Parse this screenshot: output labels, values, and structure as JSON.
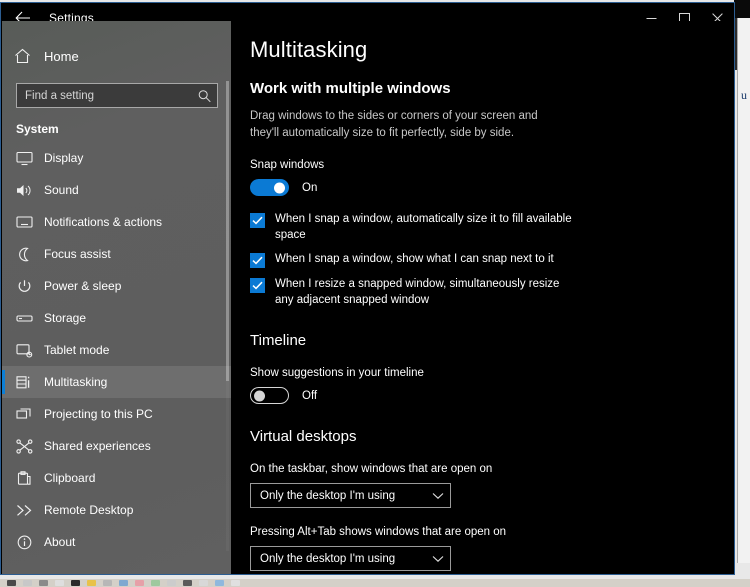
{
  "window": {
    "title": "Settings",
    "back_icon": "back-arrow-icon",
    "controls": {
      "minimize": "minimize-icon",
      "maximize": "maximize-icon",
      "close": "close-icon"
    }
  },
  "sidebar": {
    "home_label": "Home",
    "home_icon": "home-icon",
    "search": {
      "placeholder": "Find a setting",
      "value": "",
      "icon": "search-icon"
    },
    "group_title": "System",
    "items": [
      {
        "label": "Display",
        "icon": "monitor-icon",
        "selected": false
      },
      {
        "label": "Sound",
        "icon": "speaker-icon",
        "selected": false
      },
      {
        "label": "Notifications & actions",
        "icon": "notification-icon",
        "selected": false
      },
      {
        "label": "Focus assist",
        "icon": "moon-icon",
        "selected": false
      },
      {
        "label": "Power & sleep",
        "icon": "power-icon",
        "selected": false
      },
      {
        "label": "Storage",
        "icon": "drive-icon",
        "selected": false
      },
      {
        "label": "Tablet mode",
        "icon": "tablet-icon",
        "selected": false
      },
      {
        "label": "Multitasking",
        "icon": "multitasking-icon",
        "selected": true
      },
      {
        "label": "Projecting to this PC",
        "icon": "projecting-icon",
        "selected": false
      },
      {
        "label": "Shared experiences",
        "icon": "share-icon",
        "selected": false
      },
      {
        "label": "Clipboard",
        "icon": "clipboard-icon",
        "selected": false
      },
      {
        "label": "Remote Desktop",
        "icon": "remote-desktop-icon",
        "selected": false
      },
      {
        "label": "About",
        "icon": "info-icon",
        "selected": false
      }
    ]
  },
  "main": {
    "page_title": "Multitasking",
    "snap": {
      "heading": "Work with multiple windows",
      "description": "Drag windows to the sides or corners of your screen and they'll automatically size to fit perfectly, side by side.",
      "toggle_label": "Snap windows",
      "toggle_state": "On",
      "toggle_on": true,
      "checkboxes": [
        {
          "label": "When I snap a window, automatically size it to fill available space",
          "checked": true
        },
        {
          "label": "When I snap a window, show what I can snap next to it",
          "checked": true
        },
        {
          "label": "When I resize a snapped window, simultaneously resize any adjacent snapped window",
          "checked": true
        }
      ]
    },
    "timeline": {
      "heading": "Timeline",
      "toggle_label": "Show suggestions in your timeline",
      "toggle_state": "Off",
      "toggle_on": false
    },
    "virtual_desktops": {
      "heading": "Virtual desktops",
      "taskbar_label": "On the taskbar, show windows that are open on",
      "taskbar_value": "Only the desktop I'm using",
      "alttab_label": "Pressing Alt+Tab shows windows that are open on",
      "alttab_value": "Only the desktop I'm using"
    }
  },
  "background": {
    "window_letter": "u"
  },
  "colors": {
    "accent": "#0b7ad4",
    "sidebar": "#5e5e5e",
    "panel": "#000000",
    "window_border": "#2c5d91"
  }
}
